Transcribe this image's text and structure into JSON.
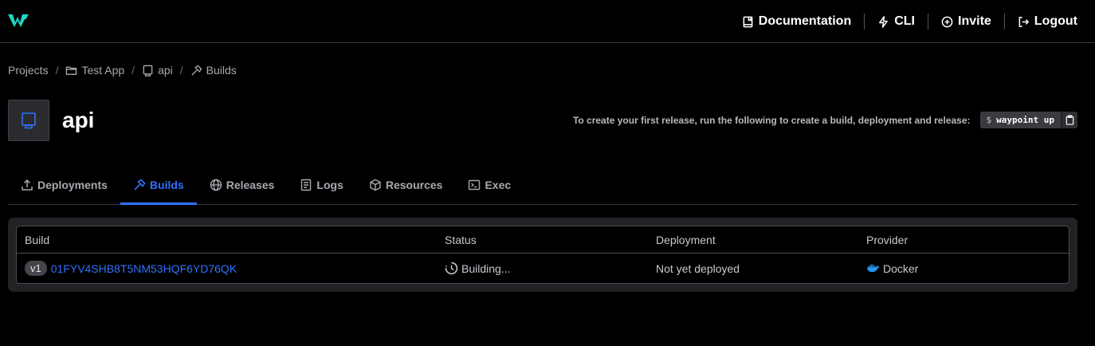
{
  "topnav": {
    "documentation": "Documentation",
    "cli": "CLI",
    "invite": "Invite",
    "logout": "Logout"
  },
  "breadcrumb": {
    "projects": "Projects",
    "project": "Test App",
    "app": "api",
    "page": "Builds"
  },
  "header": {
    "app_name": "api",
    "hint": "To create your first release, run the following to create a build, deployment and release:",
    "command_prompt": "$",
    "command": "waypoint up"
  },
  "tabs": [
    {
      "label": "Deployments",
      "icon": "upload-icon"
    },
    {
      "label": "Builds",
      "icon": "hammer-icon",
      "active": true
    },
    {
      "label": "Releases",
      "icon": "globe-icon"
    },
    {
      "label": "Logs",
      "icon": "logs-icon"
    },
    {
      "label": "Resources",
      "icon": "box-icon"
    },
    {
      "label": "Exec",
      "icon": "terminal-icon"
    }
  ],
  "table": {
    "headers": [
      "Build",
      "Status",
      "Deployment",
      "Provider"
    ],
    "rows": [
      {
        "version": "v1",
        "build_id": "01FYV4SHB8T5NM53HQF6YD76QK",
        "status": "Building...",
        "deployment": "Not yet deployed",
        "provider": "Docker"
      }
    ]
  },
  "colors": {
    "accent": "#2e72ff",
    "logo": "#1fd6c4",
    "docker": "#2496ed"
  }
}
